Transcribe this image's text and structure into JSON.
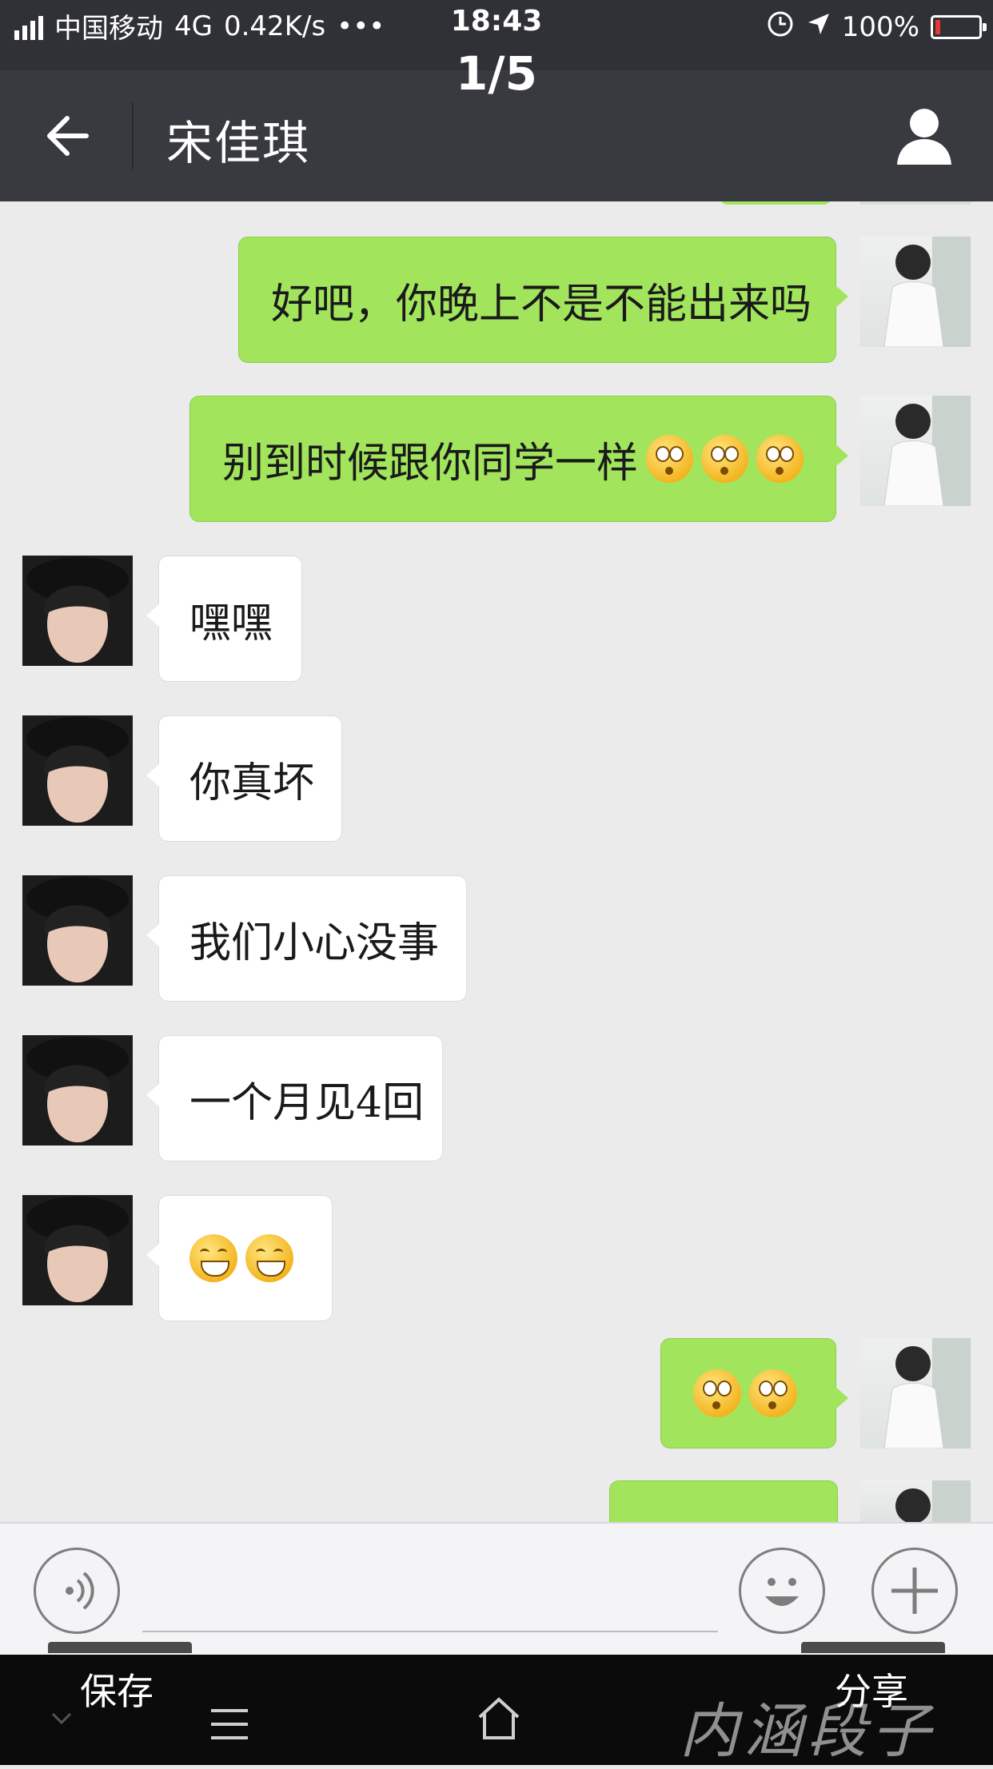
{
  "status_bar": {
    "carrier": "中国移动",
    "network": "4G",
    "speed": "0.42K/s",
    "time": "18:43",
    "battery": "100%"
  },
  "viewer": {
    "page_counter": "1/5",
    "save_label": "保存",
    "share_label": "分享",
    "watermark": "内涵段子"
  },
  "header": {
    "title": "宋佳琪"
  },
  "messages": [
    {
      "side": "me",
      "text": "好吧，你晚上不是不能出来吗",
      "emojis": []
    },
    {
      "side": "me",
      "text": "别到时候跟你同学一样",
      "emojis": [
        "surprised-emoji",
        "surprised-emoji",
        "surprised-emoji"
      ]
    },
    {
      "side": "them",
      "text": "嘿嘿",
      "emojis": []
    },
    {
      "side": "them",
      "text": "你真坏",
      "emojis": []
    },
    {
      "side": "them",
      "text": "我们小心没事",
      "emojis": []
    },
    {
      "side": "them",
      "text": "一个月见4回",
      "emojis": []
    },
    {
      "side": "them",
      "text": "",
      "emojis": [
        "grin-emoji",
        "grin-emoji"
      ]
    },
    {
      "side": "me",
      "text": "",
      "emojis": [
        "surprised-emoji",
        "surprised-emoji"
      ]
    }
  ],
  "colors": {
    "header_bg": "#383a40",
    "chat_bg": "#ebebeb",
    "my_bubble": "#a2e55d",
    "their_bubble": "#ffffff"
  },
  "icons": [
    "back-arrow-icon",
    "profile-icon",
    "voice-icon",
    "emoji-icon",
    "plus-icon",
    "menu-icon",
    "home-icon",
    "chevron-down-icon"
  ]
}
